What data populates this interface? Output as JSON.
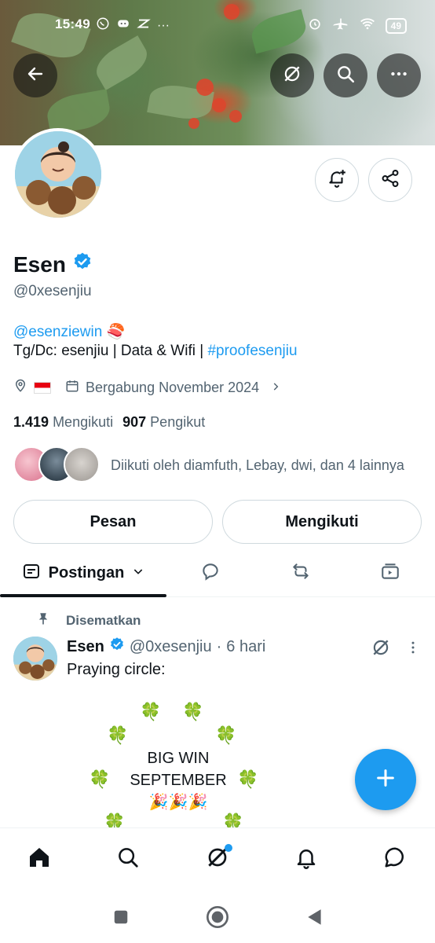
{
  "status_bar": {
    "time": "15:49",
    "battery": "49"
  },
  "profile": {
    "name": "Esen",
    "handle": "@0xesenjiu",
    "bio_mention": "@esenziewin",
    "bio_emoji": "🍣",
    "bio_line2_prefix": "Tg/Dc: esenjiu | Data & Wifi | ",
    "bio_hashtag": "#proofesenjiu",
    "location_flag": "🇮🇩",
    "joined": "Bergabung November 2024",
    "following_count": "1.419",
    "following_label": "Mengikuti",
    "followers_count": "907",
    "followers_label": "Pengikut",
    "followed_by": "Diikuti oleh diamfuth, Lebay, dwi, dan 4 lainnya"
  },
  "actions": {
    "message": "Pesan",
    "following": "Mengikuti"
  },
  "tabs": {
    "posts_label": "Postingan"
  },
  "pinned_post": {
    "pinned_label": "Disematkan",
    "author": "Esen",
    "handle": "@0xesenjiu",
    "separator": "·",
    "time": "6 hari",
    "text": "Praying circle:",
    "big_win_line1": "BIG WIN",
    "big_win_line2": "SEPTEMBER",
    "party": "🎉🎉🎉",
    "clover": "🍀"
  },
  "colors": {
    "accent": "#1d9bf0",
    "text": "#0f1419",
    "muted": "#536471",
    "border": "#cfd9de"
  },
  "icons": {
    "back": "arrow-left-icon",
    "grok": "grok-icon",
    "search": "search-icon",
    "more": "more-horizontal-icon",
    "notify": "bell-plus-icon",
    "share": "share-icon",
    "verified": "verified-badge-icon"
  }
}
